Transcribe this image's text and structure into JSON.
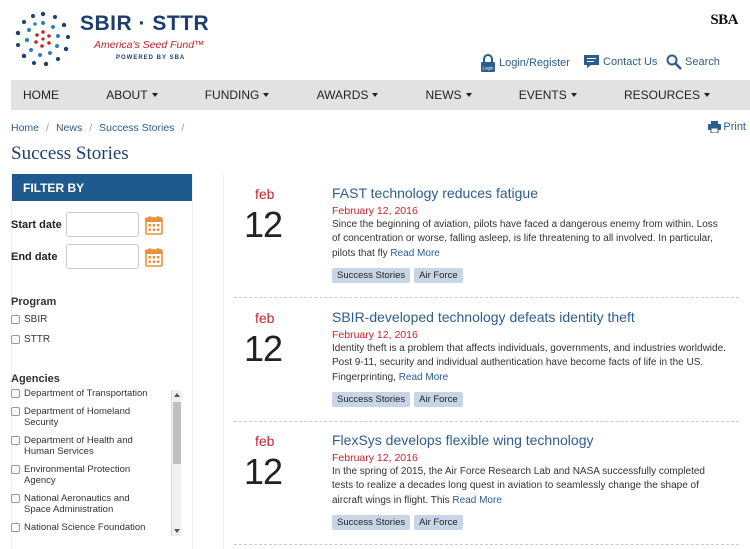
{
  "header": {
    "logo_title": "SBIR · STTR",
    "logo_tagline": "America's Seed Fund™",
    "logo_powered": "POWERED BY SBA",
    "sba_mark": "SBA",
    "login_label": "Login/Register",
    "login_icon_text": "Login",
    "contact_label": "Contact Us",
    "search_label": "Search"
  },
  "nav": {
    "items": [
      {
        "label": "HOME",
        "has_caret": false
      },
      {
        "label": "ABOUT",
        "has_caret": true
      },
      {
        "label": "FUNDING",
        "has_caret": true
      },
      {
        "label": "AWARDS",
        "has_caret": true
      },
      {
        "label": "NEWS",
        "has_caret": true
      },
      {
        "label": "EVENTS",
        "has_caret": true
      },
      {
        "label": "RESOURCES",
        "has_caret": true
      }
    ]
  },
  "breadcrumb": {
    "items": [
      "Home",
      "News",
      "Success Stories"
    ],
    "separator": "/"
  },
  "print_label": "Print",
  "page_title": "Success Stories",
  "filter": {
    "heading": "FILTER BY",
    "start_label": "Start date",
    "end_label": "End date",
    "program_label": "Program",
    "programs": [
      "SBIR",
      "STTR"
    ],
    "agencies_label": "Agencies",
    "agencies": [
      "Department of Transportation",
      "Department of Homeland Security",
      "Department of Health and Human Services",
      "Environmental Protection Agency",
      "National Aeronautics and Space Administration",
      "National Science Foundation"
    ]
  },
  "stories": [
    {
      "month": "feb",
      "day": "12",
      "title": "FAST technology reduces fatigue",
      "date": "February 12, 2016",
      "excerpt": "Since the beginning of aviation, pilots have faced a dangerous enemy from within. Loss of concentration or worse, falling asleep, is life threatening to all involved. In particular, pilots that fly",
      "read_more": "Read More",
      "tags": [
        "Success Stories",
        "Air Force"
      ]
    },
    {
      "month": "feb",
      "day": "12",
      "title": "SBIR-developed technology defeats identity theft",
      "date": "February 12, 2016",
      "excerpt": "Identity theft is a problem that affects individuals, governments, and industries worldwide. Post 9-11, security and individual authentication have become facts of life in the US. Fingerprinting,",
      "read_more": "Read More",
      "tags": [
        "Success Stories",
        "Air Force"
      ]
    },
    {
      "month": "feb",
      "day": "12",
      "title": "FlexSys develops flexible wing technology",
      "date": "February 12, 2016",
      "excerpt": "In the spring of 2015, the Air Force Research Lab and NASA successfully completed tests to realize a decades long quest in aviation to seamlessly change the shape of aircraft wings in flight. This",
      "read_more": "Read More",
      "tags": [
        "Success Stories",
        "Air Force"
      ]
    }
  ],
  "colors": {
    "brand_navy": "#1d3e6e",
    "link_blue": "#2c5d8f",
    "accent_red": "#c8232c",
    "filter_header": "#1f5a8e",
    "calendar_orange": "#e8913a",
    "tag_bg": "#c7d6e6",
    "nav_bg": "#e2e2e2"
  }
}
